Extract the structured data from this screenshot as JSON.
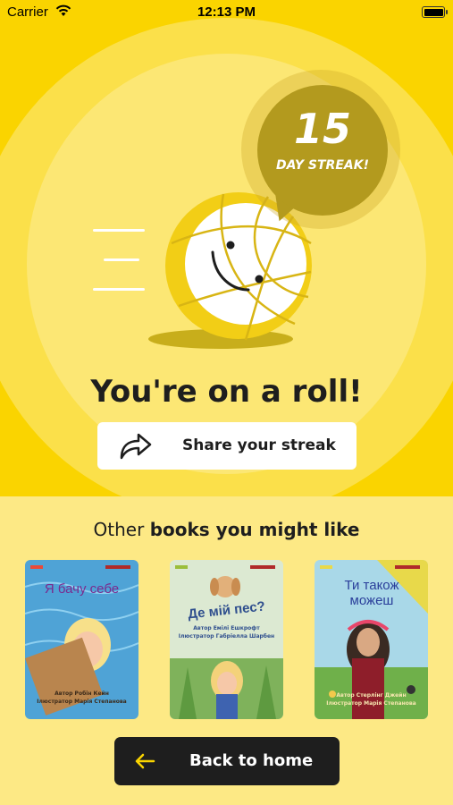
{
  "status_bar": {
    "carrier": "Carrier",
    "time": "12:13 PM"
  },
  "streak": {
    "count": "15",
    "label": "DAY STREAK!"
  },
  "headline": "You're on a roll!",
  "share": {
    "label": "Share your streak"
  },
  "recommendations": {
    "title_plain": "Other",
    "title_bold": "books you might like",
    "books": [
      {
        "title": "Я бачу себе",
        "credits": [
          "Автор Робін Кейн",
          "Ілюстратор Марія Степанова"
        ]
      },
      {
        "title": "Де мій пес?",
        "credits": [
          "Автор Емілі Ешкрофт",
          "Ілюстратор Габріелла Шарбен"
        ]
      },
      {
        "title": "Ти також можеш",
        "credits": [
          "Автор Стерлінг Джейн",
          "Ілюстратор Марія Степанова"
        ]
      }
    ]
  },
  "back": {
    "label": "Back to home"
  },
  "colors": {
    "brand_yellow": "#FAD400",
    "badge_gold": "#B39A1E",
    "dark": "#1E1E1E",
    "background": "#FDE985"
  }
}
